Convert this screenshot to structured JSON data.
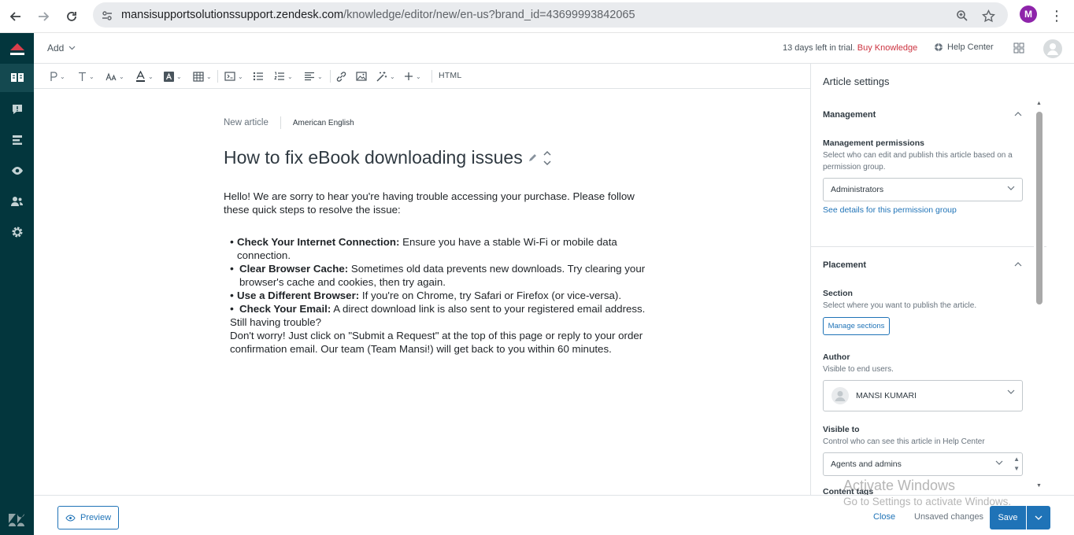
{
  "browser": {
    "url_host": "mansisupportsolutionssupport.zendesk.com",
    "url_path": "/knowledge/editor/new/en-us?brand_id=43699993842065",
    "profile_initial": "M"
  },
  "header": {
    "add_label": "Add",
    "trial_text": "13 days left in trial.",
    "buy_label": "Buy Knowledge",
    "help_center_label": "Help Center"
  },
  "toolbar": {
    "html_label": "HTML"
  },
  "editor": {
    "status": "New article",
    "language": "American English",
    "title": "How to fix eBook downloading issues",
    "intro": "Hello! We are sorry to hear you're having trouble accessing your purchase. Please follow these quick steps to resolve the issue:",
    "steps": [
      {
        "bold": "Check Your Internet Connection:",
        "text": " Ensure you have a stable Wi-Fi or mobile data connection."
      },
      {
        "bold": "Clear Browser Cache:",
        "text": " Sometimes old data prevents new downloads. Try clearing your browser's cache and cookies, then try again."
      },
      {
        "bold": "Use a Different Browser:",
        "text": " If you're on Chrome, try Safari or Firefox (or vice-versa)."
      },
      {
        "bold": "Check Your Email:",
        "text": " A direct download link is also sent to your registered email address."
      }
    ],
    "still_trouble": "Still having trouble?",
    "closing": "Don't worry! Just click on \"Submit a Request\" at the top of this page or reply to your order confirmation email. Our team (Team Mansi!) will get back to you within 60 minutes."
  },
  "panel": {
    "title": "Article settings",
    "management": {
      "heading": "Management",
      "permissions_label": "Management permissions",
      "permissions_hint": "Select who can edit and publish this article based on a permission group.",
      "permissions_value": "Administrators",
      "details_link": "See details for this permission group"
    },
    "placement": {
      "heading": "Placement",
      "section_label": "Section",
      "section_hint": "Select where you want to publish the article.",
      "manage_sections": "Manage sections",
      "author_label": "Author",
      "author_hint": "Visible to end users.",
      "author_value": "MANSI KUMARI",
      "visible_label": "Visible to",
      "visible_hint": "Control who can see this article in Help Center",
      "visible_value": "Agents and admins",
      "content_tags_label": "Content tags"
    }
  },
  "footer": {
    "preview_label": "Preview",
    "close_label": "Close",
    "unsaved_label": "Unsaved changes",
    "save_label": "Save"
  },
  "watermark": {
    "line1": "Activate Windows",
    "line2": "Go to Settings to activate Windows."
  },
  "colors": {
    "sidebar_bg": "#03363d",
    "primary_blue": "#1f73b7",
    "buy_red": "#cc3340",
    "logo_red": "#d93f4c"
  }
}
